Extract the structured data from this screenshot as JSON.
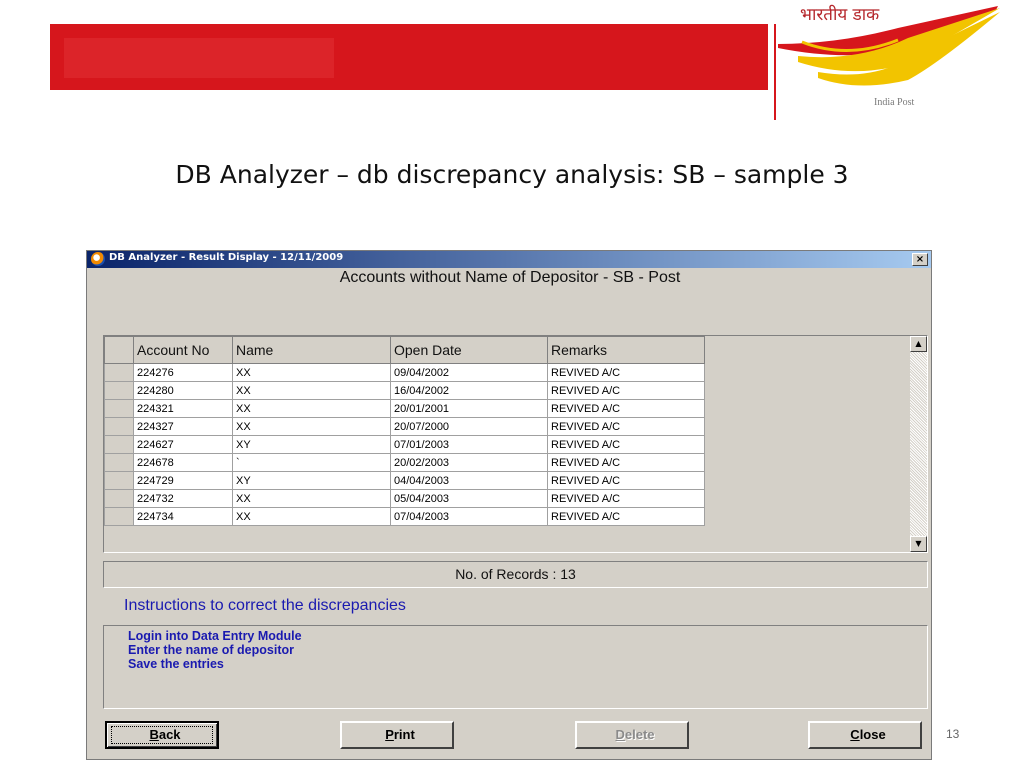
{
  "slide": {
    "title": "DB Analyzer – db discrepancy analysis: SB – sample 3",
    "page_number": "13",
    "logo_hindi": "भारतीय डाक",
    "logo_english": "India Post",
    "banner_color": "#d6161c"
  },
  "window": {
    "title": "DB Analyzer - Result Display - 12/11/2009",
    "close_glyph": "×",
    "report_title": "Accounts without Name of Depositor - SB - Post",
    "grid": {
      "columns": [
        "Account No",
        "Name",
        "Open Date",
        "Remarks"
      ],
      "rows": [
        [
          "224276",
          "XX",
          "09/04/2002",
          "REVIVED A/C"
        ],
        [
          "224280",
          "XX",
          "16/04/2002",
          "REVIVED A/C"
        ],
        [
          "224321",
          "XX",
          "20/01/2001",
          "REVIVED A/C"
        ],
        [
          "224327",
          "XX",
          "20/07/2000",
          "REVIVED A/C"
        ],
        [
          "224627",
          "XY",
          "07/01/2003",
          "REVIVED A/C"
        ],
        [
          "224678",
          "`",
          "20/02/2003",
          "REVIVED A/C"
        ],
        [
          "224729",
          "XY",
          "04/04/2003",
          "REVIVED A/C"
        ],
        [
          "224732",
          "XX",
          "05/04/2003",
          "REVIVED A/C"
        ],
        [
          "224734",
          "XX",
          "07/04/2003",
          "REVIVED A/C"
        ]
      ]
    },
    "scroll_up_glyph": "▲",
    "scroll_down_glyph": "▼",
    "records_text": "No. of Records : 13",
    "instructions_title": "Instructions to correct the discrepancies",
    "instructions": [
      "Login into Data Entry Module",
      "Enter the name of depositor",
      "Save the entries"
    ],
    "buttons": {
      "back": "Back",
      "print": "Print",
      "delete": "Delete",
      "close": "Close"
    },
    "title_gradient_start": "#0a246a",
    "instruction_color": "#1a1ab0"
  }
}
